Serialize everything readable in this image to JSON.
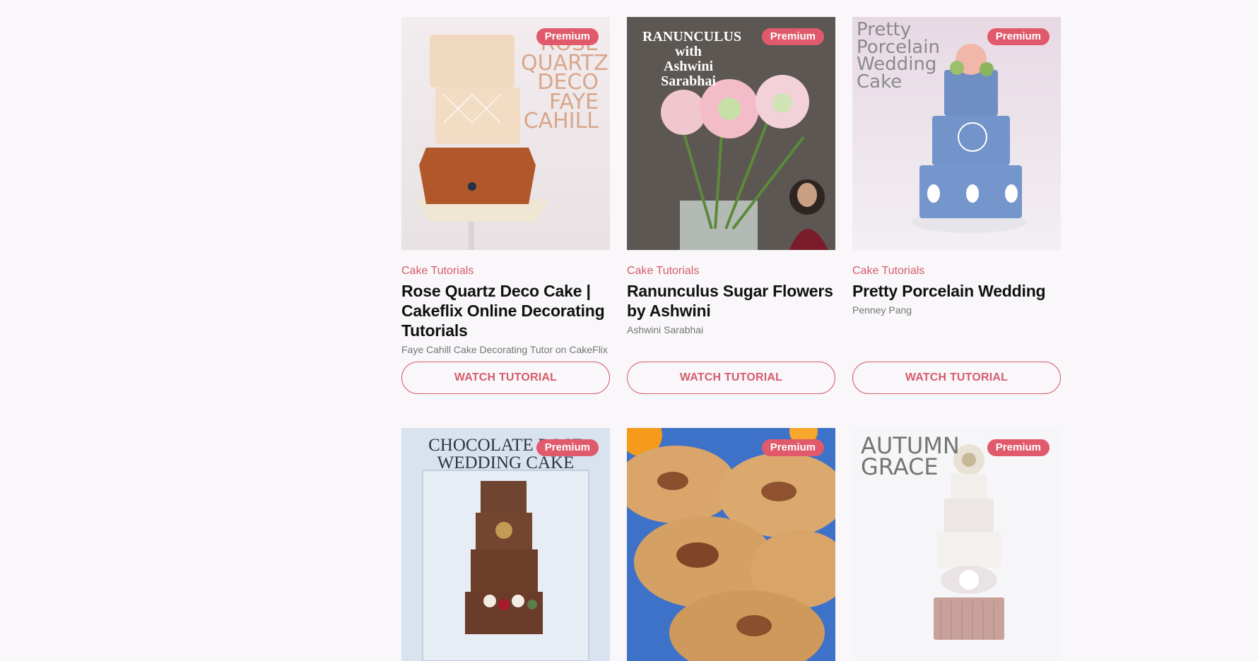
{
  "cards": [
    {
      "badge": "Premium",
      "category": "Cake Tutorials",
      "title": "Rose Quartz Deco Cake | Cakeflix Online Decorating Tutorials",
      "author": "Faye Cahill Cake Decorating Tutor on CakeFlix",
      "button": "WATCH TUTORIAL",
      "image_text": "ROSE\nQUARTZ\nDECO\nFAYE CAHILL"
    },
    {
      "badge": "Premium",
      "category": "Cake Tutorials",
      "title": "Ranunculus Sugar Flowers by Ashwini",
      "author": "Ashwini Sarabhai",
      "button": "WATCH TUTORIAL",
      "image_text": "RANUNCULUS\nwith\nAshwini Sarabhai"
    },
    {
      "badge": "Premium",
      "category": "Cake Tutorials",
      "title": "Pretty Porcelain Wedding",
      "author": "Penney Pang",
      "button": "WATCH TUTORIAL",
      "image_text": "Pretty\nPorcelain\nWedding\nCake"
    },
    {
      "badge": "Premium",
      "image_text": "CHOCOLATE ROSE\nWEDDING CAKE"
    },
    {
      "badge": "Premium"
    },
    {
      "badge": "Premium",
      "image_text": "AUTUMN\nGRACE"
    }
  ],
  "colors": {
    "accent": "#d65c6c",
    "badge_bg": "#e05a6c",
    "page_bg": "#f9f7fa"
  }
}
